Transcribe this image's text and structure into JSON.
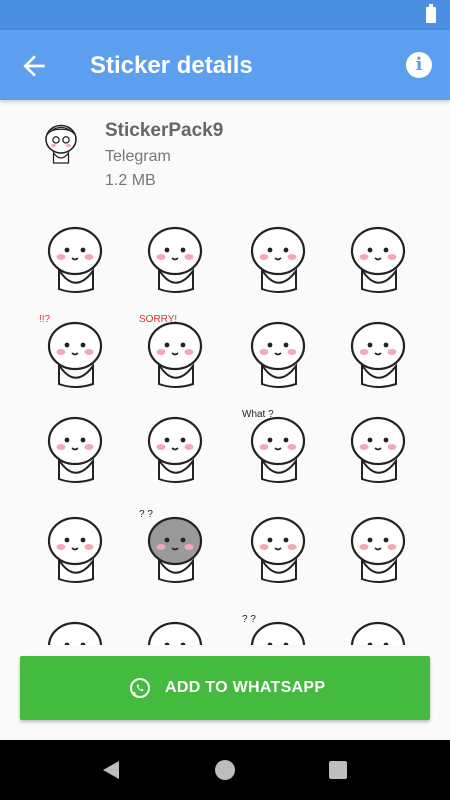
{
  "app_bar": {
    "title": "Sticker details",
    "back_icon": "arrow-back-icon",
    "info_icon": "info-icon",
    "info_glyph": "i"
  },
  "pack": {
    "name": "StickerPack9",
    "publisher": "Telegram",
    "size": "1.2 MB"
  },
  "stickers": [
    {
      "name": "sticker-grandma-fan",
      "annotation": ""
    },
    {
      "name": "sticker-old-man-cane",
      "annotation": ""
    },
    {
      "name": "sticker-hands-cheeks",
      "annotation": ""
    },
    {
      "name": "sticker-driving",
      "annotation": ""
    },
    {
      "name": "sticker-surprised-exclaim",
      "annotation": "!!?"
    },
    {
      "name": "sticker-sorry",
      "annotation": "SORRY!"
    },
    {
      "name": "sticker-beard-phone",
      "annotation": ""
    },
    {
      "name": "sticker-eating-noodles",
      "annotation": ""
    },
    {
      "name": "sticker-scale-eating",
      "annotation": ""
    },
    {
      "name": "sticker-heart-blush",
      "annotation": ""
    },
    {
      "name": "sticker-what-lying",
      "annotation": "What ?"
    },
    {
      "name": "sticker-long-nose",
      "annotation": ""
    },
    {
      "name": "sticker-crying",
      "annotation": ""
    },
    {
      "name": "sticker-grey-confused-chair",
      "annotation": "? ?"
    },
    {
      "name": "sticker-beanbag",
      "annotation": ""
    },
    {
      "name": "sticker-sweat-drop",
      "annotation": ""
    },
    {
      "name": "sticker-partial-1",
      "annotation": ""
    },
    {
      "name": "sticker-partial-2",
      "annotation": ""
    },
    {
      "name": "sticker-partial-3",
      "annotation": "? ?"
    },
    {
      "name": "sticker-partial-4",
      "annotation": ""
    }
  ],
  "actions": {
    "add_label": "ADD TO WHATSAPP",
    "add_icon": "whatsapp-icon"
  },
  "colors": {
    "status_bar": "#4a8fe0",
    "app_bar": "#5b9fee",
    "add_button": "#44bb3f",
    "blush": "#f7a8b5"
  },
  "system_nav": {
    "back_icon": "nav-back-icon",
    "home_icon": "nav-home-icon",
    "recents_icon": "nav-recents-icon"
  }
}
